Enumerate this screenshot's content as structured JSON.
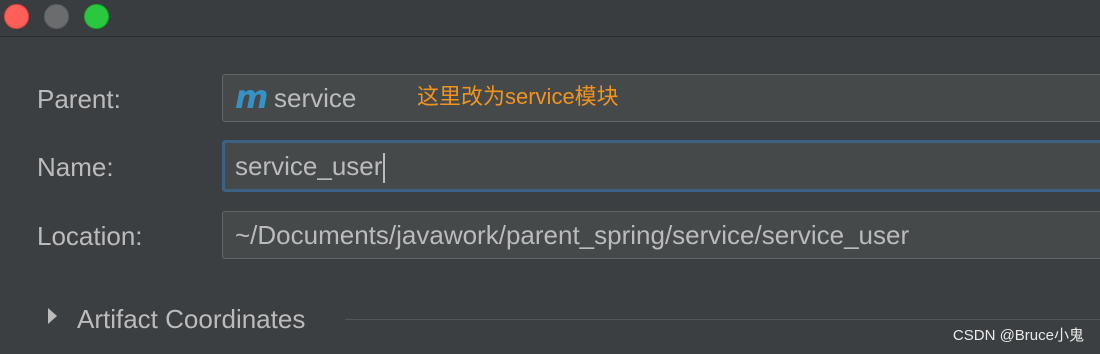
{
  "window": {
    "controls": {
      "close_color": "#fe5f57",
      "minimize_color": "#6a6c6e",
      "maximize_color": "#28c840"
    }
  },
  "form": {
    "parent": {
      "label": "Parent:",
      "icon": "maven-module-icon",
      "icon_glyph": "m",
      "value": "service"
    },
    "name": {
      "label": "Name:",
      "value": "service_user"
    },
    "location": {
      "label": "Location:",
      "value": "~/Documents/javawork/parent_spring/service/service_user"
    }
  },
  "annotation": {
    "text": "这里改为service模块",
    "color": "#f0941e"
  },
  "section": {
    "title": "Artifact Coordinates",
    "expanded": false
  },
  "watermark": {
    "text": "CSDN @Bruce小鬼"
  }
}
